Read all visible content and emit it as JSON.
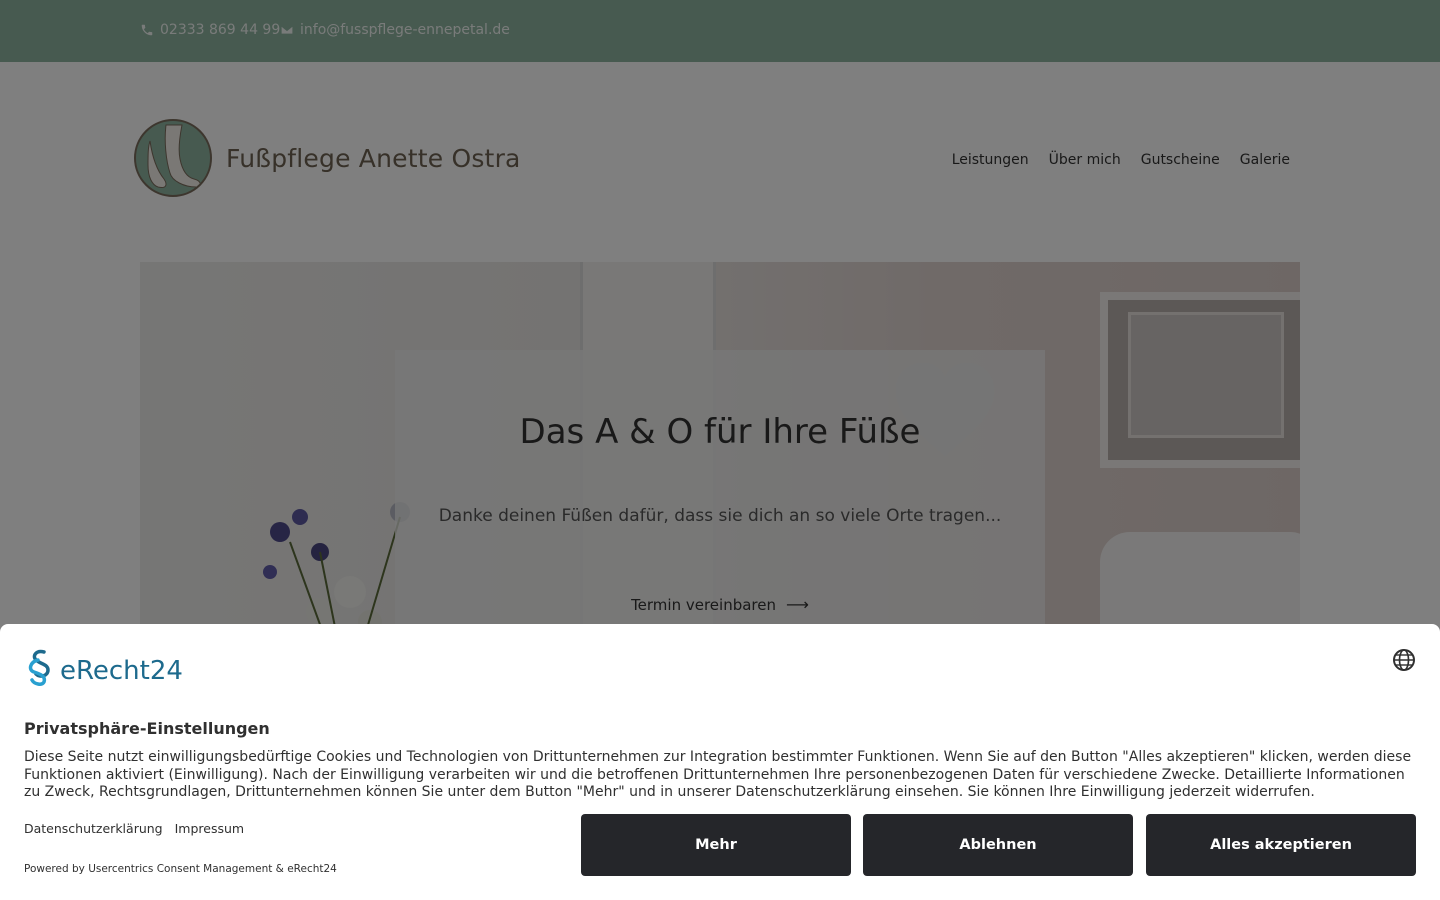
{
  "topbar": {
    "phone": "02333 869 44 99",
    "email": "info@fusspflege-ennepetal.de",
    "phone_icon": "phone-icon",
    "email_icon": "envelope-icon"
  },
  "brand": {
    "name": "Fußpflege Anette Ostra"
  },
  "nav": {
    "items": [
      "Leistungen",
      "Über mich",
      "Gutscheine",
      "Galerie"
    ]
  },
  "hero": {
    "title": "Das A & O für Ihre Füße",
    "subtitle": "Danke deinen Füßen dafür, dass sie dich an so viele Orte tragen...",
    "cta": "Termin vereinbaren"
  },
  "consent": {
    "logo_text": "eRecht24",
    "title": "Privatsphäre-Einstellungen",
    "text": "Diese Seite nutzt einwilligungsbedürftige Cookies und Technologien von Drittunternehmen zur Integration bestimmter Funktionen. Wenn Sie auf den Button \"Alles akzeptieren\" klicken, werden diese Funktionen aktiviert (Einwilligung). Nach der Einwilligung verarbeiten wir und die betroffenen Drittunternehmen Ihre personenbezogenen Daten für verschiedene Zwecke. Detaillierte Informationen zu Zweck, Rechtsgrundlagen, Drittunternehmen können Sie unter dem Button \"Mehr\" und in unserer Datenschutzerklärung einsehen. Sie können Ihre Einwilligung jederzeit widerrufen.",
    "links": [
      "Datenschutzerklärung",
      "Impressum"
    ],
    "powered": "Powered by Usercentrics Consent Management & eRecht24",
    "buttons": {
      "more": "Mehr",
      "deny": "Ablehnen",
      "accept": "Alles akzeptieren"
    },
    "button_color": "#25262a",
    "language_icon": "globe-icon"
  },
  "colors": {
    "topbar": "#8fb4a1",
    "brand_text": "#6e6252",
    "erecht_blue": "#1d6a8d"
  }
}
